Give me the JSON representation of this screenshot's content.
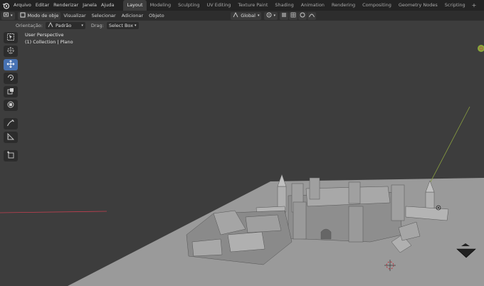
{
  "topbar": {
    "menus": [
      "Arquivo",
      "Editar",
      "Renderizar",
      "Janela",
      "Ajuda"
    ],
    "workspaces": [
      "Layout",
      "Modeling",
      "Sculpting",
      "UV Editing",
      "Texture Paint",
      "Shading",
      "Animation",
      "Rendering",
      "Compositing",
      "Geometry Nodes",
      "Scripting"
    ],
    "active_workspace": "Layout",
    "add_tab": "+"
  },
  "header": {
    "mode": "Modo de obje",
    "menus": [
      "Visualizar",
      "Selecionar",
      "Adicionar",
      "Objeto"
    ],
    "transform_orientation": "Global"
  },
  "toolsettings": {
    "orientation_label": "Orientação:",
    "orientation_value": "Padrão",
    "drag_label": "Drag:",
    "drag_value": "Select Box"
  },
  "viewport": {
    "view_name": "User Perspective",
    "collection_info": "(1) Collection | Plano"
  },
  "toolbar_icons": [
    "select-box-icon",
    "cursor-icon",
    "move-icon",
    "rotate-icon",
    "scale-icon",
    "transform-icon",
    "annotate-icon",
    "measure-icon",
    "add-cube-icon"
  ],
  "colors": {
    "accent": "#4772b3",
    "background": "#3d3d3d",
    "floor": "#9a9a9a",
    "x_axis": "#c04050",
    "y_axis": "#8aa040"
  }
}
